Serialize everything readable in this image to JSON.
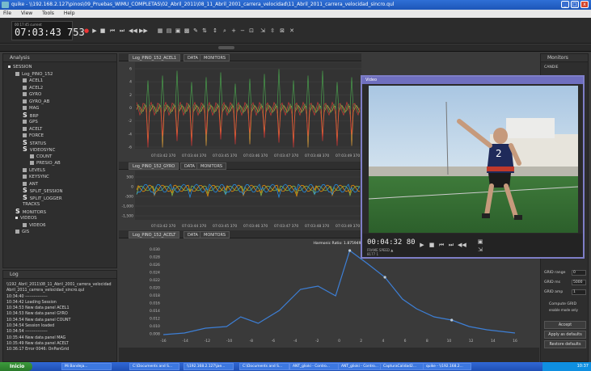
{
  "window": {
    "title": "quike - \\\\192.168.2.127\\pinos\\09_Pruebas_WIMU_COMPLETAS\\02_Abril_2011\\08_11_Abril_2001_carrera_velocidad\\11_Abril_2011_carrera_velocidad_sincro.qul"
  },
  "menu": [
    "File",
    "View",
    "Tools",
    "Help"
  ],
  "clock": {
    "label": "00:17:45   current",
    "time": "07:03:43 753"
  },
  "analysis": {
    "title": "Analysis",
    "tree": [
      "SESSION",
      "Log_PINO_152",
      "ACEL1",
      "ACEL2",
      "GYRO",
      "GYRO_AB",
      "MAG",
      "BRP",
      "GPS",
      "ACELT",
      "FORCE",
      "STATUS",
      "VIDEOSYNC",
      "COUNT",
      "PRESIO_AB",
      "LEVELS",
      "KEYSYNC",
      "ANT",
      "SPLIT_SESSION",
      "SPLIT_LOGGER",
      "TRACKS",
      "MONITORS",
      "VIDEOS",
      "VIDEO6",
      "GIS"
    ]
  },
  "log": {
    "title": "Log",
    "lines": [
      "\\\\192_Abril_2011\\08_11_Abril_2001_carrera_velocidad",
      "Abril_2011_carrera_velocidad_sincro.qul",
      "10:34:40 ----------------",
      "10:34:42 Loading Session",
      "10:34:53 New data panel ACEL1",
      "10:34:53 New data panel GYRO",
      "10:34:54 New data panel COUNT",
      "10:34:54 Session loaded",
      "10:34:54 ----------------",
      "10:35:44 New data panel MAG",
      "10:35:49 New data panel ACELT",
      "10:36:17 Error 0046: OnPanGrid"
    ]
  },
  "panel1": {
    "tabs": [
      "Log_PINO_152_ACEL1",
      "DATA",
      "MONITORS"
    ]
  },
  "panel2": {
    "tabs": [
      "Log_PINO_152_GYRO",
      "DATA",
      "MONITORS"
    ]
  },
  "panel3": {
    "tabs": [
      "Log_PINO_152_ACELT",
      "DATA",
      "MONITORS"
    ],
    "subtitle": "Harmonic Ratio: 1.875949"
  },
  "monitors": {
    "title": "Monitors",
    "item": "CANDIE",
    "grid_range_label": "GRID range",
    "grid_range": "0",
    "grid_ms_label": "GRID ms",
    "grid_ms": "5000",
    "grid_amp_label": "GRID amp",
    "grid_amp": "1",
    "compute_label": "Compute GRID",
    "compute_sub": "enable mode only",
    "accept": "Accept",
    "apply_defaults": "Apply as defaults",
    "restore_defaults": "Restore defaults"
  },
  "video": {
    "title": "Video",
    "time": "00:04:32 80",
    "frames": "FRAME   SPEED   ▲",
    "frames2": "8177     1"
  },
  "taskbar": {
    "start": "Inicio",
    "tasks": [
      "Mi Bandeja...",
      "C:\\Documents and S...",
      "\\\\192.168.2.127\\jae...",
      "C:\\Documents and S...",
      "ANT_glioki - Contro...",
      "ANT_glioki - Contro...",
      "CapturaCalidad2...",
      "quike - \\\\192.168.2..."
    ],
    "clock": "10:37"
  },
  "axes": {
    "p1_ticks": [
      "07:03:42 370",
      "07:03:44 370",
      "07:03:45 370",
      "07:03:46 370",
      "07:03:47 370",
      "07:03:48 370",
      "07:03:49 370"
    ],
    "p1_y": [
      "6",
      "4",
      "2",
      "0",
      "-2",
      "-4",
      "-6"
    ],
    "p2_y": [
      "500",
      "0",
      "-500",
      "-1,000",
      "-1,500"
    ],
    "p3_y": [
      "0.030",
      "0.028",
      "0.026",
      "0.024",
      "0.022",
      "0.020",
      "0.018",
      "0.016",
      "0.014",
      "0.012",
      "0.010",
      "0.008"
    ],
    "p3_x": [
      "-16",
      "-14",
      "-12",
      "-10",
      "-8",
      "-6",
      "-4",
      "-2",
      "0",
      "2",
      "4",
      "6",
      "8",
      "10",
      "12",
      "14",
      "16"
    ]
  }
}
